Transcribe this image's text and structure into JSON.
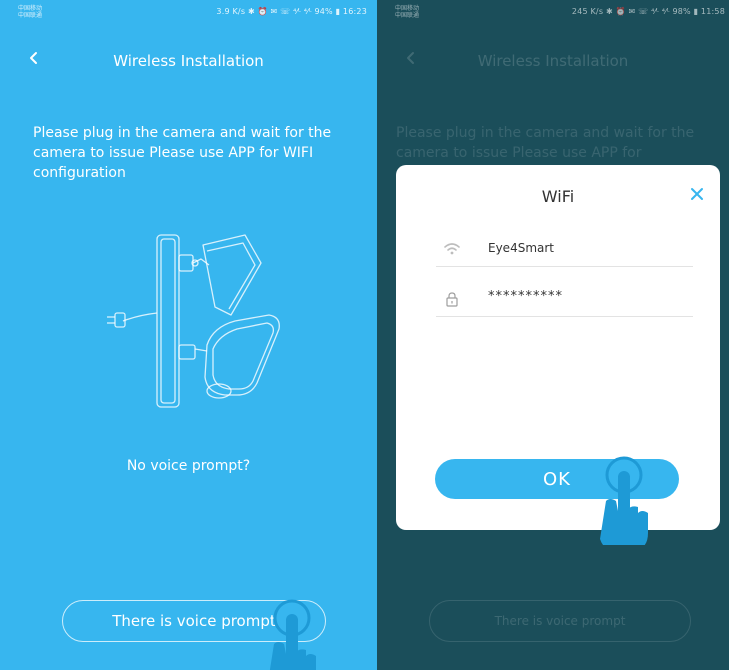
{
  "left_screen": {
    "status_bar": {
      "carrier": "中国移动 中国联通",
      "right_text": "3.9 K/s ✱ ⏰ ✉ ☏ ⁴⁄ᴸ ⁴⁄ᴸ 94% ▮ 16:23"
    },
    "header": {
      "title": "Wireless Installation"
    },
    "instructions": "Please plug in the camera and wait for the camera to issue Please use APP for WIFI configuration",
    "no_voice_prompt": "No voice prompt?",
    "voice_button_label": "There is voice prompt"
  },
  "right_screen": {
    "status_bar": {
      "carrier": "中国移动 中国联通",
      "right_text": "245 K/s ✱ ⏰ ✉ ☏ ⁴⁄ᴸ ⁴⁄ᴸ 98% ▮ 11:58"
    },
    "header": {
      "title": "Wireless Installation"
    },
    "instructions": "Please plug in the camera and wait for the camera to issue Please use APP for",
    "voice_button_label": "There is voice prompt",
    "dialog": {
      "title": "WiFi",
      "ssid": "Eye4Smart",
      "password": "**********",
      "ok_label": "OK"
    }
  },
  "colors": {
    "primary_blue": "#37b6ef",
    "overlay_background": "#1b4e5a",
    "dialog_background": "#ffffff",
    "hand_blue": "#1e9ad6"
  },
  "icons": [
    "back-arrow-icon",
    "camera-plug-illustration",
    "pointing-hand-icon",
    "close-icon",
    "wifi-icon",
    "lock-icon"
  ]
}
